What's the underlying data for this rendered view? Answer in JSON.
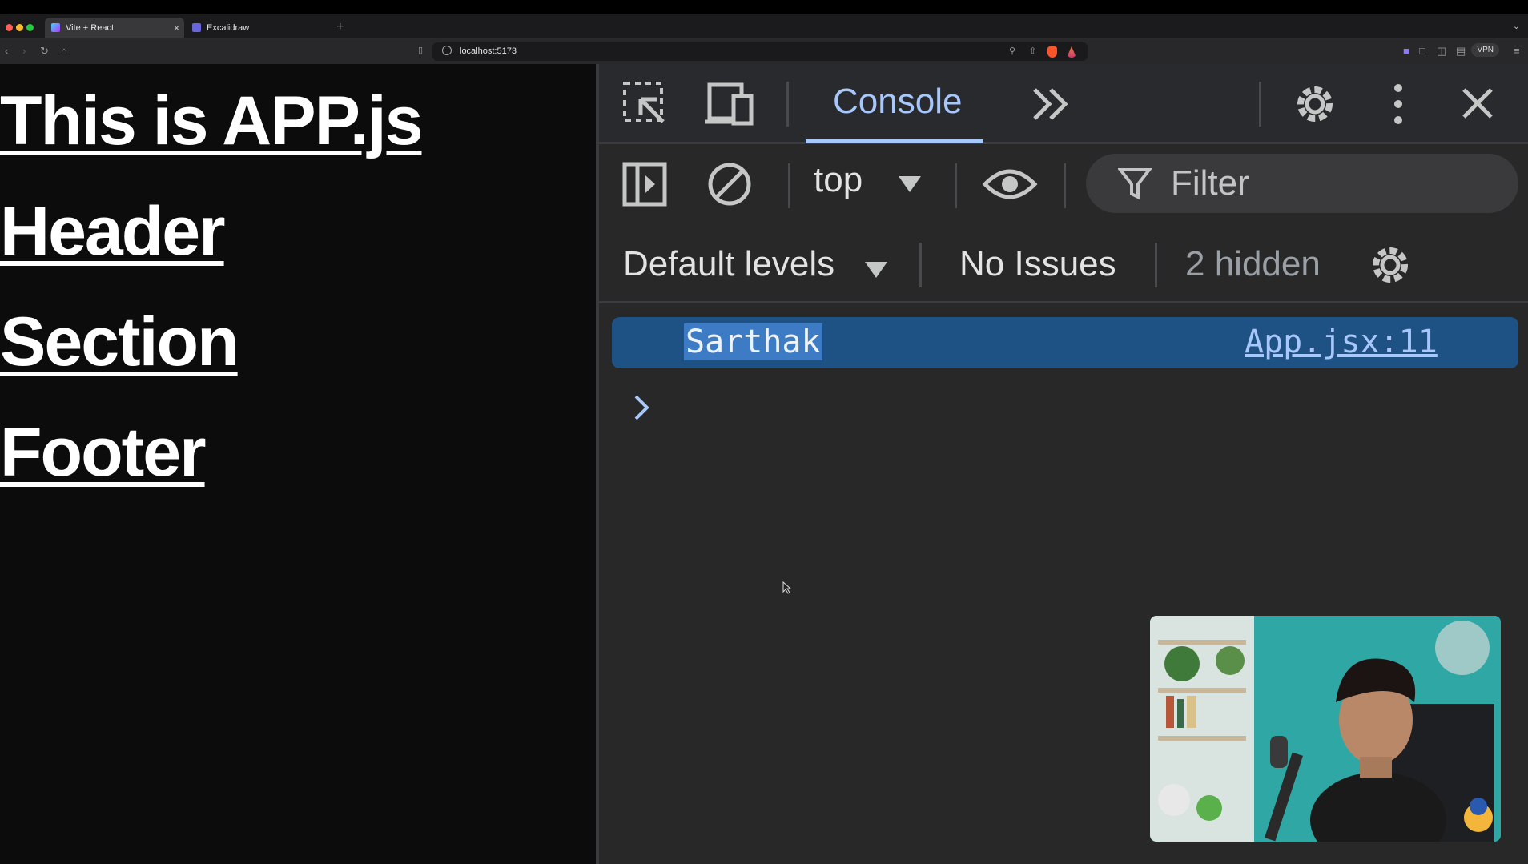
{
  "browser": {
    "tabs": [
      {
        "title": "Vite + React",
        "close": "×",
        "active": true
      },
      {
        "title": "Excalidraw",
        "active": false
      }
    ],
    "new_tab": "+",
    "tabs_menu": "⌄",
    "url": "localhost:5173",
    "vpn_label": "VPN"
  },
  "page": {
    "headings": [
      "This is APP.js",
      "Header",
      "Section",
      "Footer"
    ]
  },
  "devtools": {
    "active_tab": "Console",
    "context": "top",
    "filter_placeholder": "Filter",
    "levels": "Default levels",
    "issues": "No Issues",
    "hidden": "2 hidden",
    "log": {
      "message": "Sarthak",
      "source": "App.jsx:11"
    }
  },
  "colors": {
    "accent": "#a8c7fa",
    "log_bg": "#1e5284",
    "devtools_bg": "#282828"
  }
}
